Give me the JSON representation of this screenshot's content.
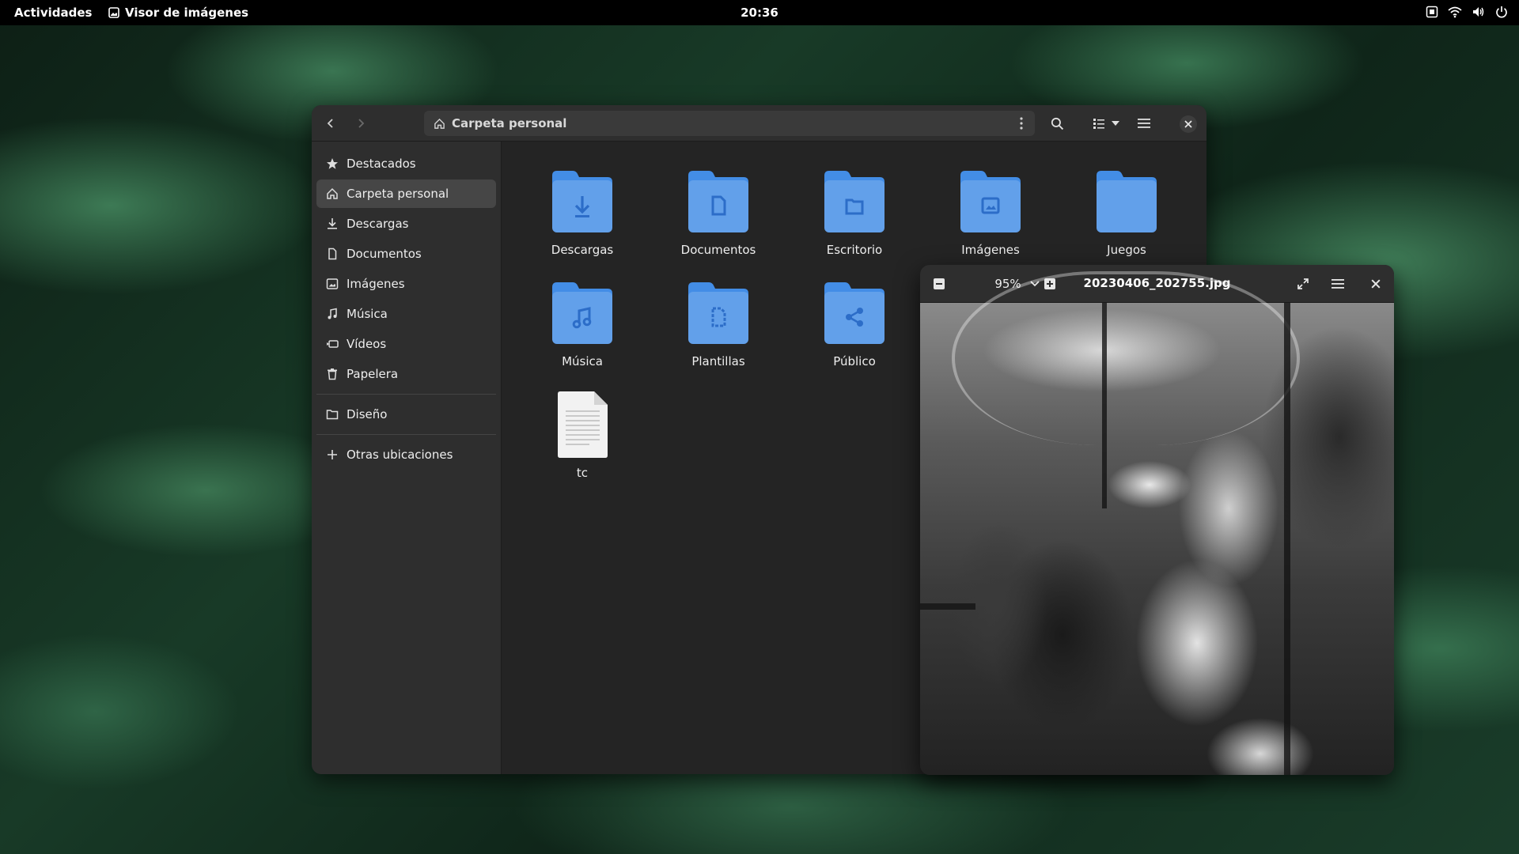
{
  "topbar": {
    "activities": "Actividades",
    "app_name": "Visor de imágenes",
    "clock": "20:36"
  },
  "files": {
    "path": "Carpeta personal",
    "sidebar": {
      "items": [
        {
          "label": "Destacados",
          "icon": "star-icon"
        },
        {
          "label": "Carpeta personal",
          "icon": "home-icon",
          "active": true
        },
        {
          "label": "Descargas",
          "icon": "download-icon"
        },
        {
          "label": "Documentos",
          "icon": "document-icon"
        },
        {
          "label": "Imágenes",
          "icon": "image-icon"
        },
        {
          "label": "Música",
          "icon": "music-icon"
        },
        {
          "label": "Vídeos",
          "icon": "video-icon"
        },
        {
          "label": "Papelera",
          "icon": "trash-icon"
        }
      ],
      "bookmarks": [
        {
          "label": "Diseño",
          "icon": "folder-icon"
        }
      ],
      "other_locations": "Otras ubicaciones"
    },
    "folders": [
      {
        "label": "Descargas",
        "emblem": "download"
      },
      {
        "label": "Documentos",
        "emblem": "document"
      },
      {
        "label": "Escritorio",
        "emblem": "folder"
      },
      {
        "label": "Imágenes",
        "emblem": "image"
      },
      {
        "label": "Juegos",
        "emblem": "none"
      },
      {
        "label": "Música",
        "emblem": "music"
      },
      {
        "label": "Plantillas",
        "emblem": "template"
      },
      {
        "label": "Público",
        "emblem": "share"
      }
    ],
    "file": {
      "label": "tc"
    }
  },
  "viewer": {
    "zoom": "95%",
    "filename": "20230406_202755.jpg"
  },
  "colors": {
    "folder_body": "#62a0ea",
    "folder_tab": "#438de6",
    "folder_emblem": "#2c6dc8",
    "window_bg": "#242424",
    "header_bg": "#2e2e2e"
  }
}
